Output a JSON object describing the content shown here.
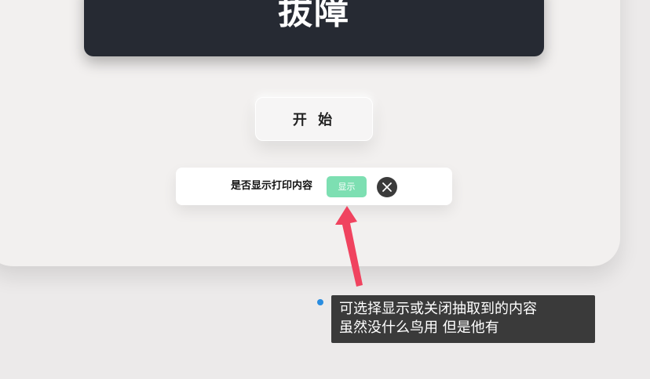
{
  "display": {
    "text": "拔障"
  },
  "start_button": {
    "label": "开 始"
  },
  "print_toggle": {
    "label": "是否显示打印内容",
    "show_label": "显示"
  },
  "annotation": {
    "line1": "可选择显示或关闭抽取到的内容",
    "line2": "虽然没什么鸟用 但是他有"
  },
  "colors": {
    "display_bg": "#262a33",
    "show_button": "#7ddfb2",
    "close_button": "#3b3b3b",
    "arrow": "#f0435f",
    "tooltip_bg": "#3a3a3a"
  },
  "icons": [
    "close-icon"
  ]
}
